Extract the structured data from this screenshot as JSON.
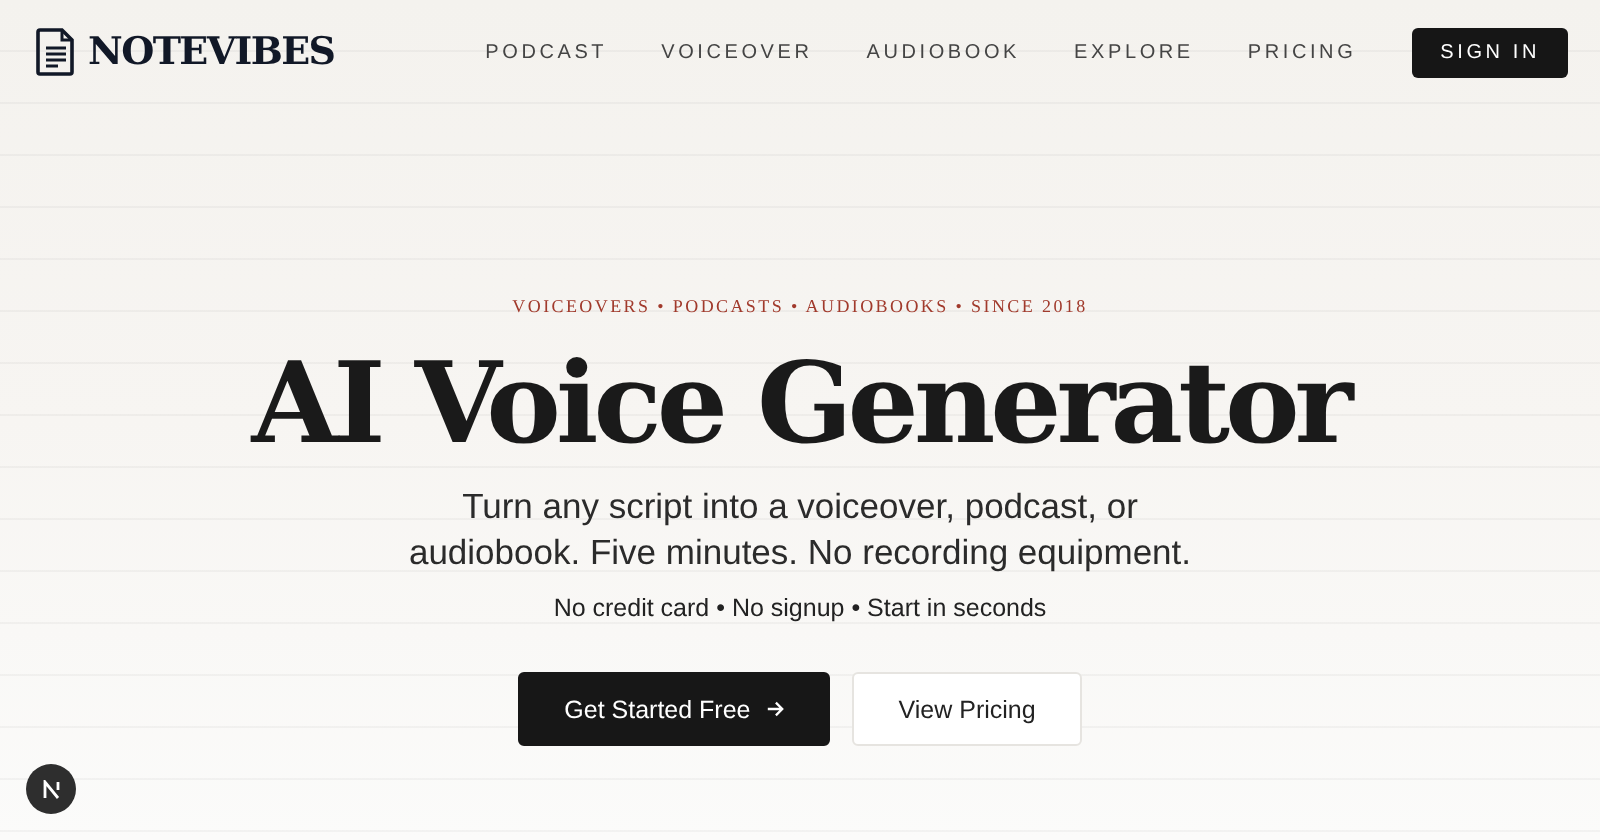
{
  "brand": {
    "name": "NOTEVIBES"
  },
  "nav": {
    "links": [
      "PODCAST",
      "VOICEOVER",
      "AUDIOBOOK",
      "EXPLORE",
      "PRICING"
    ],
    "sign_in": "SIGN IN"
  },
  "hero": {
    "eyebrow": "VOICEOVERS • PODCASTS • AUDIOBOOKS • SINCE 2018",
    "title": "AI Voice Generator",
    "subtitle": "Turn any script into a voiceover, podcast, or audiobook. Five minutes. No recording equipment.",
    "note": "No credit card • No signup • Start in seconds",
    "buttons": [
      {
        "label": "Get Started Free",
        "kind": "primary"
      },
      {
        "label": "View Pricing",
        "kind": "secondary"
      }
    ]
  }
}
